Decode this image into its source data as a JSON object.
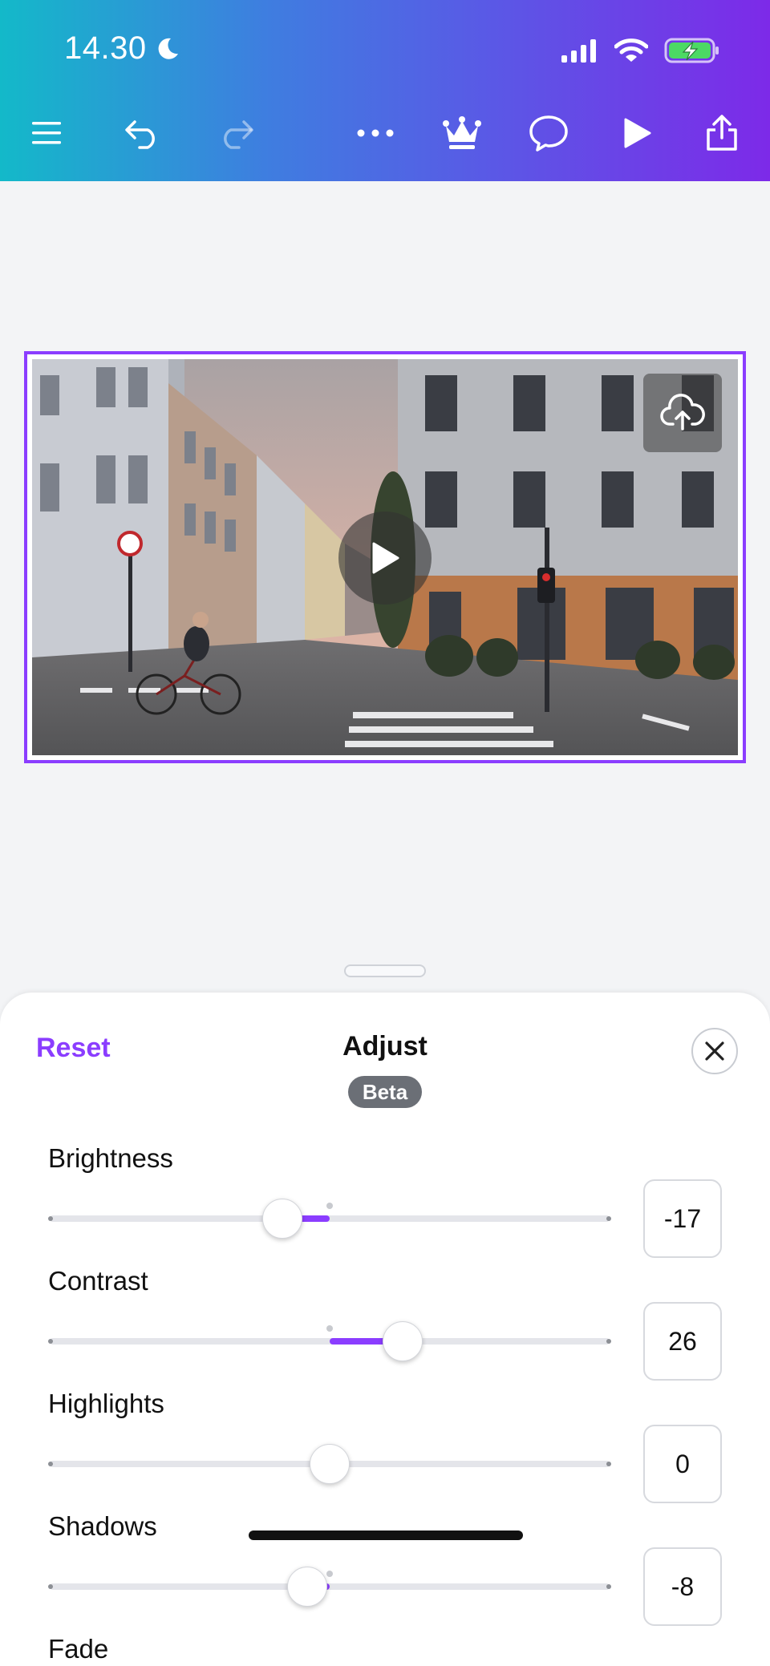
{
  "status_bar": {
    "time": "14.30"
  },
  "toolbar": {
    "menu": "menu-icon",
    "undo": "undo-icon",
    "redo": "redo-icon",
    "more": "more-icon",
    "premium": "crown-icon",
    "comment": "comment-icon",
    "play": "play-icon",
    "share": "share-icon"
  },
  "colors": {
    "accent": "#8b3dff",
    "header_start": "#13b9c9",
    "header_end": "#7d2ae8"
  },
  "adjust": {
    "reset_label": "Reset",
    "title": "Adjust",
    "badge": "Beta",
    "sliders": [
      {
        "label": "Brightness",
        "value": "-17",
        "level": -17
      },
      {
        "label": "Contrast",
        "value": "26",
        "level": 26
      },
      {
        "label": "Highlights",
        "value": "0",
        "level": 0
      },
      {
        "label": "Shadows",
        "value": "-8",
        "level": -8
      },
      {
        "label": "Fade"
      }
    ]
  }
}
